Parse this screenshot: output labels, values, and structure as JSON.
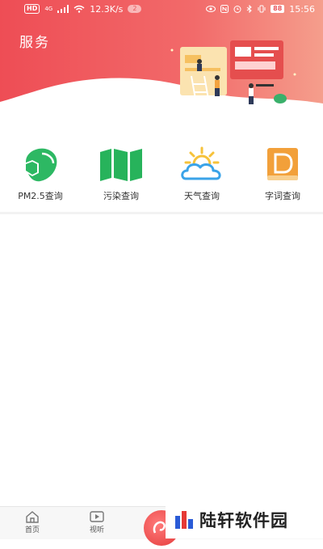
{
  "status_bar": {
    "hd": "HD",
    "network_badge": "4G",
    "speed": "12.3K/s",
    "notification_count": "2",
    "battery": "88",
    "time": "15:56"
  },
  "header": {
    "title": "服务"
  },
  "services": [
    {
      "label": "PM2.5查询",
      "icon": "mask-icon"
    },
    {
      "label": "污染查询",
      "icon": "map-icon"
    },
    {
      "label": "天气查询",
      "icon": "sun-cloud-icon"
    },
    {
      "label": "字词查询",
      "icon": "dictionary-icon"
    }
  ],
  "bottom_nav": {
    "items": [
      {
        "label": "首页",
        "icon": "home-icon"
      },
      {
        "label": "视听",
        "icon": "play-icon"
      }
    ]
  },
  "watermark": {
    "text": "陆轩软件园"
  },
  "colors": {
    "header_gradient_start": "#ee4d55",
    "header_gradient_end": "#f59e8c",
    "mask_green": "#2db863",
    "map_green": "#27b35b",
    "weather_blue": "#3aa3e8",
    "weather_sun": "#f6c23a",
    "dict_orange": "#f2a03a"
  }
}
